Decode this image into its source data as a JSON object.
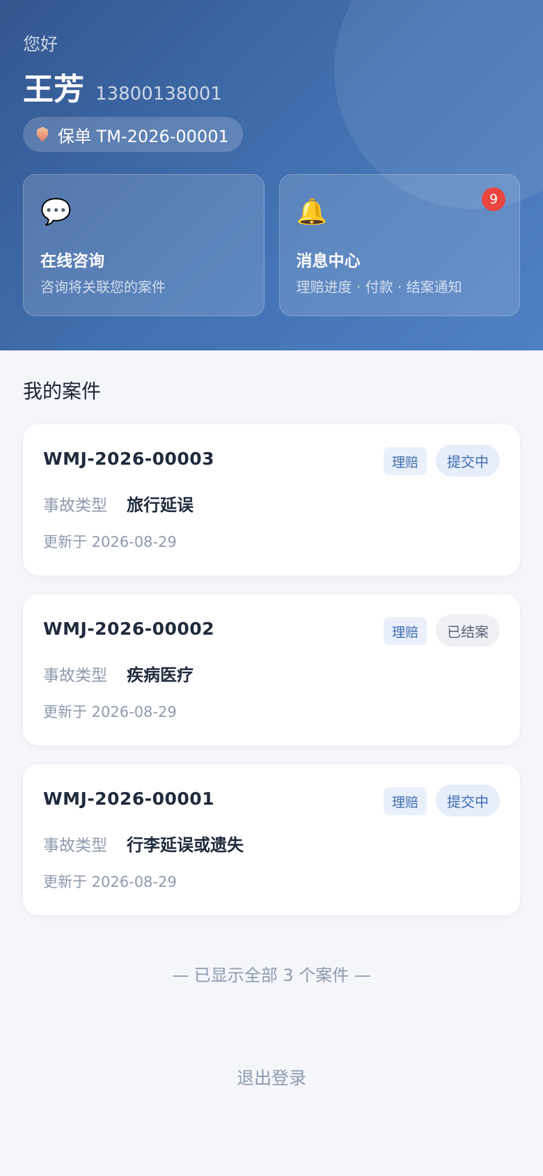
{
  "header": {
    "greeting": "您好",
    "user_name": "王芳",
    "phone": "13800138001",
    "policy_label": "保单 TM-2026-00001",
    "policy_icon": "shield-icon",
    "cards": [
      {
        "icon": "chat-bubble-icon",
        "emoji": "💬",
        "title": "在线咨询",
        "subtitle": "咨询将关联您的案件"
      },
      {
        "icon": "bell-icon",
        "emoji": "🔔",
        "title": "消息中心",
        "subtitle": "理赔进度 · 付款 · 结案通知",
        "badge_count": "9"
      }
    ]
  },
  "cases": {
    "section_title": "我的案件",
    "detail_label": "事故类型",
    "items": [
      {
        "id": "WMJ-2026-00003",
        "type_tag": "理赔",
        "status": "提交中",
        "accident_type": "旅行延误",
        "updated": "更新于 2026-08-29"
      },
      {
        "id": "WMJ-2026-00002",
        "type_tag": "理赔",
        "status": "已结案",
        "accident_type": "疾病医疗",
        "updated": "更新于 2026-08-29"
      },
      {
        "id": "WMJ-2026-00001",
        "type_tag": "理赔",
        "status": "提交中",
        "accident_type": "行李延误或遗失",
        "updated": "更新于 2026-08-29"
      }
    ],
    "footer": "— 已显示全部 3 个案件 —"
  },
  "logout_label": "退出登录",
  "colors": {
    "header_start": "#34568f",
    "header_end": "#4f80c4",
    "accent": "#3f6bb0",
    "badge": "#e8463f",
    "background": "#f4f6fa"
  }
}
